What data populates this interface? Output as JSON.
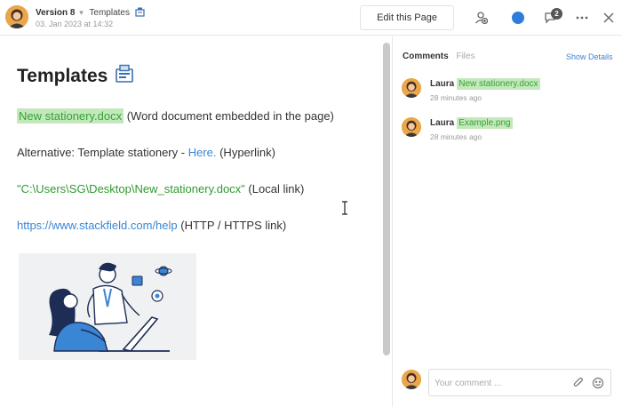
{
  "header": {
    "version": "Version 8",
    "separator": "▾",
    "page_name": "Templates",
    "date": "03. Jan 2023 at 14:32",
    "edit_label": "Edit this Page",
    "notification_count": "2",
    "status_color": "#2e7ddc"
  },
  "document": {
    "title": "Templates",
    "lines": [
      {
        "link": "New stationery.docx",
        "suffix": " (Word document embedded in the page)"
      },
      {
        "prefix": "Alternative: Template stationery - ",
        "link": "Here.",
        "suffix": " (Hyperlink)"
      },
      {
        "link": "\"C:\\Users\\SG\\Desktop\\New_stationery.docx\"",
        "suffix": " (Local link)"
      },
      {
        "link": "https://www.stackfield.com/help",
        "suffix": " (HTTP / HTTPS link)"
      }
    ]
  },
  "panel": {
    "tab_comments": "Comments",
    "tab_files": "Files",
    "show_details": "Show Details",
    "comments": [
      {
        "author": "Laura",
        "attachment": "New stationery.docx",
        "time": "28 minutes ago"
      },
      {
        "author": "Laura",
        "attachment": "Example.png",
        "time": "28 minutes ago"
      }
    ],
    "input_placeholder": "Your comment ..."
  },
  "icons": {
    "page_icon": "stationery-icon",
    "share": "share-users-icon",
    "chat": "chat-bubble-icon",
    "more": "more-dots-icon",
    "close": "close-icon",
    "attach": "paperclip-icon",
    "emoji": "emoji-icon"
  },
  "colors": {
    "link_blue": "#3a86d4",
    "link_green": "#2f9a2f",
    "chip_bg": "#c3e8bc"
  }
}
